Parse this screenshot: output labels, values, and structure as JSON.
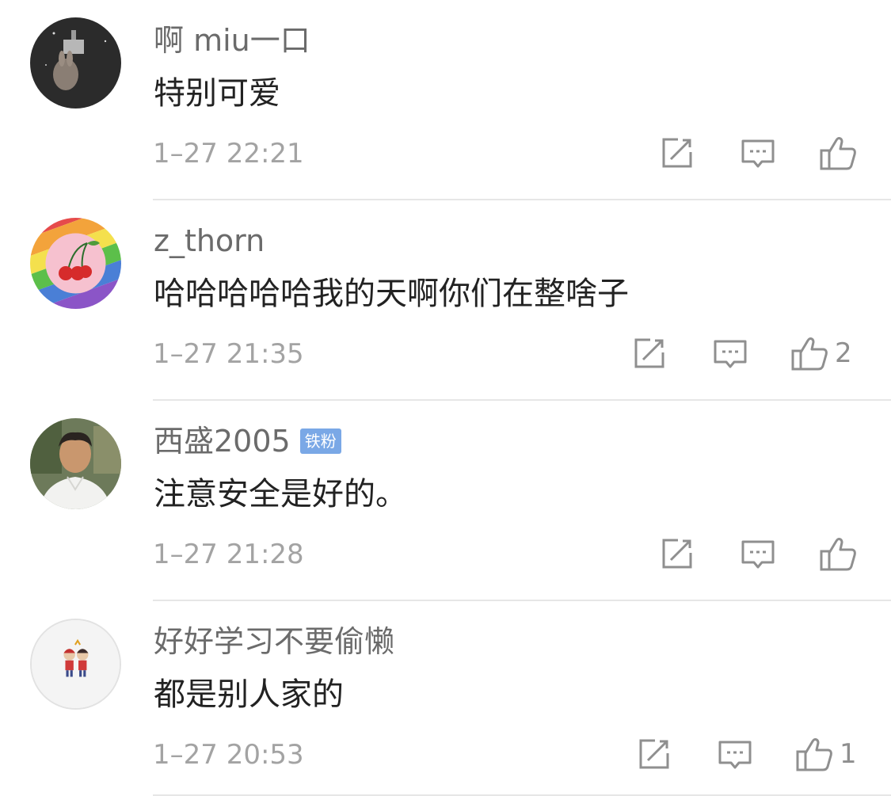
{
  "comments": [
    {
      "username": "啊 miu一口",
      "badge": "",
      "text": "特别可爱",
      "time": "1–27 22:21",
      "likes": "",
      "avatar_icon": "moon-rabbit-avatar"
    },
    {
      "username": "z_thorn",
      "badge": "",
      "text": "哈哈哈哈哈我的天啊你们在整啥子",
      "time": "1–27 21:35",
      "likes": "2",
      "avatar_icon": "rainbow-cherry-avatar"
    },
    {
      "username": "西盛2005",
      "badge": "铁粉",
      "text": "注意安全是好的。",
      "time": "1–27 21:28",
      "likes": "",
      "avatar_icon": "man-portrait-avatar"
    },
    {
      "username": "好好学习不要偷懒",
      "badge": "",
      "text": "都是别人家的",
      "time": "1–27 20:53",
      "likes": "1",
      "avatar_icon": "cartoon-kids-avatar"
    }
  ],
  "icons": {
    "repost": "share-edit-icon",
    "reply": "comment-bubble-icon",
    "like": "thumbs-up-icon"
  },
  "colors": {
    "secondary_text": "#a3a3a3",
    "badge_bg": "#7aa8e6",
    "divider": "#e6e6e6"
  }
}
